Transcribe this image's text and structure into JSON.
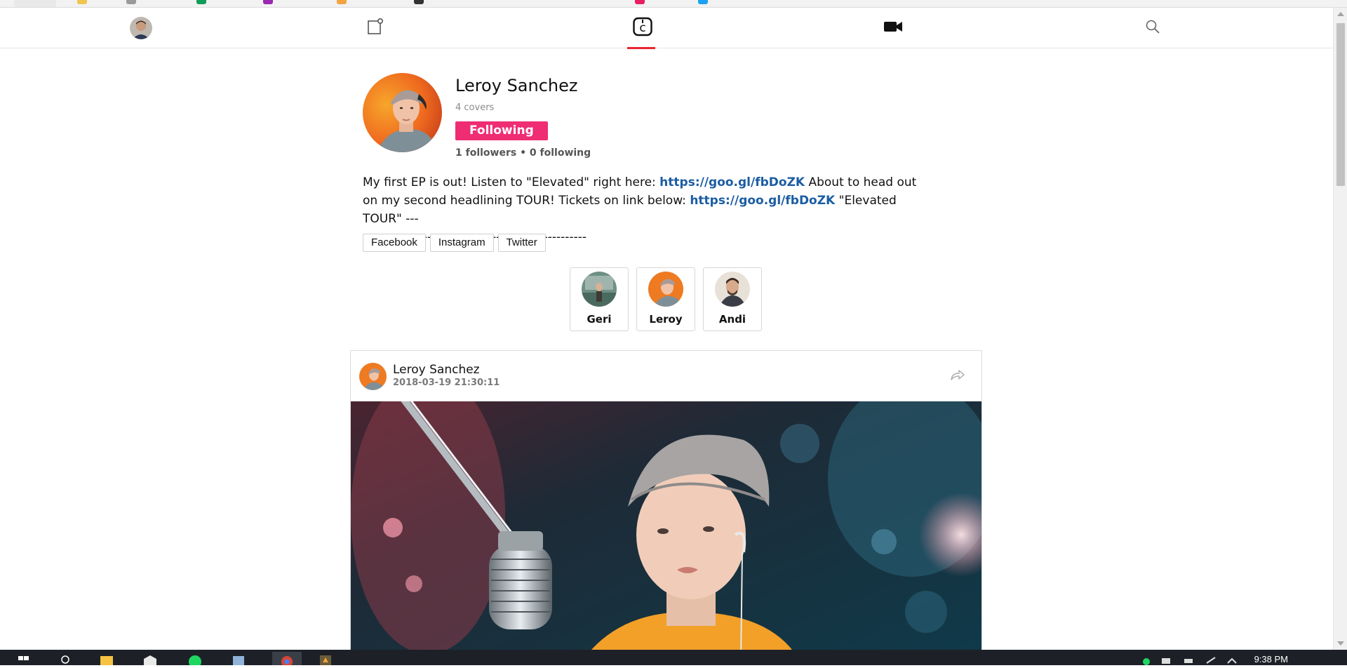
{
  "colors": {
    "accent_red": "#e8262f",
    "follow_pink": "#ee2d73",
    "link_blue": "#1b5da3"
  },
  "nav": {
    "items": [
      {
        "name": "profile-avatar",
        "icon": "user-avatar"
      },
      {
        "name": "compose",
        "icon": "compose-icon"
      },
      {
        "name": "covers",
        "icon": "c-logo-icon",
        "active": true
      },
      {
        "name": "video",
        "icon": "video-camera-icon"
      },
      {
        "name": "search",
        "icon": "search-icon"
      }
    ]
  },
  "profile": {
    "name": "Leroy Sanchez",
    "covers": "4 covers",
    "follow_label": "Following",
    "stats": "1 followers • 0 following",
    "bio": {
      "part1": "My first EP is out! Listen to \"Elevated\" right here: ",
      "link1": "https://goo.gl/fbDoZK",
      "part2": " About to head out on my second headlining TOUR! Tickets on link below: ",
      "link2": "https://goo.gl/fbDoZK",
      "part3": " \"Elevated TOUR\" ---",
      "dashes": "----------------------------------------------------"
    },
    "social": [
      "Facebook",
      "Instagram",
      "Twitter"
    ]
  },
  "collaborators": [
    "Geri",
    "Leroy",
    "Andi"
  ],
  "post": {
    "author": "Leroy Sanchez",
    "date": "2018-03-19 21:30:11"
  },
  "taskbar": {
    "time": "9:38 PM"
  }
}
